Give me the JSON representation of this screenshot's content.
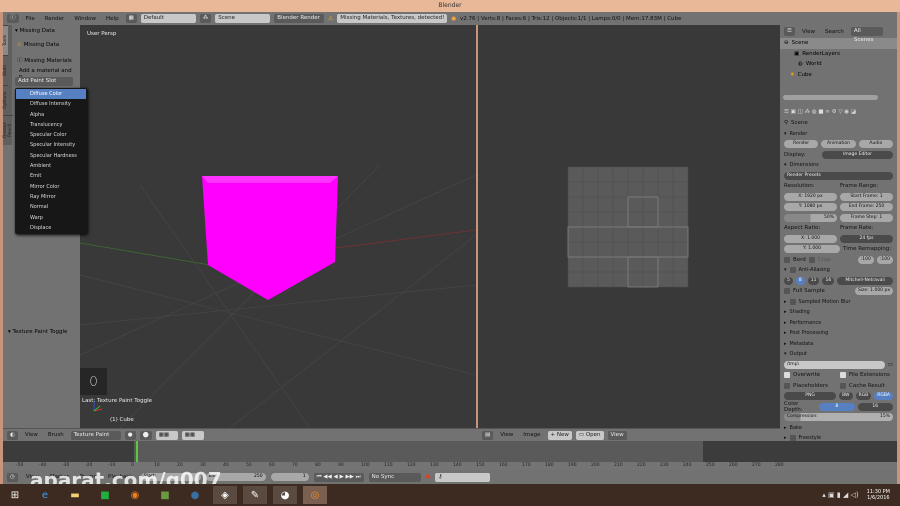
{
  "window": {
    "title": "Blender"
  },
  "info": {
    "menus": [
      "File",
      "Render",
      "Window",
      "Help"
    ],
    "layout": "Default",
    "scene": "Scene",
    "engine": "Blender Render",
    "warning": "Missing Materials, Textures, detected!",
    "stats": "v2.76 | Verts:8 | Faces:6 | Tris:12 | Objects:1/1 | Lamps:0/0 | Mem:17.83M | Cube"
  },
  "toolshelf": {
    "tabs": [
      "Tools",
      "Slots",
      "Options",
      "Grease Pencil"
    ],
    "panel": "Missing Data",
    "missing_data": "Missing Data",
    "missing_materials": "Missing Materials",
    "hint": "Add a material and p...",
    "add_slot": "Add Paint Slot",
    "op_panel": "Texture Paint Toggle"
  },
  "dropdown": {
    "items": [
      "Diffuse Color",
      "Diffuse Intensity",
      "Alpha",
      "Translucency",
      "Specular Color",
      "Specular Intensity",
      "Specular Hardness",
      "Ambient",
      "Emit",
      "Mirror Color",
      "Ray Mirror",
      "Normal",
      "Warp",
      "Displace"
    ],
    "selected": 0
  },
  "viewport": {
    "label": "User Persp",
    "last_op": "Last: Texture Paint Toggle",
    "object": "(1) Cube",
    "cube_color": "#ff00ff"
  },
  "view3d_header": {
    "view": "View",
    "brush": "Brush",
    "mode": "Texture Paint"
  },
  "image_header": {
    "view": "View",
    "image": "Image",
    "new": "New",
    "open": "Open",
    "view_mode": "View"
  },
  "outliner": {
    "view": "View",
    "search": "Search",
    "filter": "All Scenes",
    "items": [
      "Scene",
      "RenderLayers",
      "World",
      "Cube"
    ]
  },
  "properties": {
    "context": "Scene",
    "render": "Render",
    "render_btn": "Render",
    "animation_btn": "Animation",
    "audio_btn": "Audio",
    "display_label": "Display:",
    "display": "Image Editor",
    "dimensions": "Dimensions",
    "presets": "Render Presets",
    "resolution": "Resolution:",
    "res_x": "X:",
    "res_x_val": "1920 px",
    "res_y": "Y:",
    "res_y_val": "1080 px",
    "res_pct": "50%",
    "frame_range": "Frame Range:",
    "start": "Start Frame:",
    "start_val": "1",
    "end": "End Frame:",
    "end_val": "250",
    "step": "Frame Step:",
    "step_val": "1",
    "aspect": "Aspect Ratio:",
    "asp_x": "X:",
    "asp_x_val": "1.000",
    "asp_y": "Y:",
    "asp_y_val": "1.000",
    "frame_rate": "Frame Rate:",
    "fps": "24 fps",
    "remap": "Time Remapping:",
    "remap_old": ":100",
    "remap_new": ":100",
    "border": "Bord",
    "crop": "Crop",
    "aa": "Anti-Aliasing",
    "aa_samples": [
      "5",
      "8",
      "11",
      "16"
    ],
    "aa_filter": "Mitchell-Netravali",
    "full_sample": "Full Sample",
    "size": "Size:",
    "size_val": "1.000 px",
    "collapsed": [
      "Sampled Motion Blur",
      "Shading",
      "Performance",
      "Post Processing",
      "Metadata"
    ],
    "output": "Output",
    "path": "/tmp\\",
    "overwrite": "Overwrite",
    "file_ext": "File Extensions",
    "placeholders": "Placeholders",
    "cache": "Cache Result",
    "format": "PNG",
    "color_modes": [
      "BW",
      "RGB",
      "RGBA"
    ],
    "color_depth": "Color Depth:",
    "depth_8": "8",
    "depth_16": "16",
    "compression": "Compression:",
    "compression_val": "15%",
    "bake": "Bake",
    "freestyle": "Freestyle"
  },
  "timeline": {
    "ticks": [
      "-50",
      "-40",
      "-30",
      "-20",
      "-10",
      "0",
      "10",
      "20",
      "30",
      "40",
      "50",
      "60",
      "70",
      "80",
      "90",
      "100",
      "110",
      "120",
      "130",
      "140",
      "150",
      "160",
      "170",
      "180",
      "190",
      "200",
      "210",
      "220",
      "230",
      "240",
      "250",
      "260",
      "270",
      "280"
    ],
    "menus": [
      "View",
      "Marker",
      "Frame",
      "Playback"
    ],
    "start": "Start:",
    "end": "End:",
    "end_val": "250",
    "current": "1",
    "sync": "No Sync"
  },
  "taskbar": {
    "time": "11:30 PM",
    "date": "1/6/2016"
  },
  "watermark": "aparat.com/g007"
}
